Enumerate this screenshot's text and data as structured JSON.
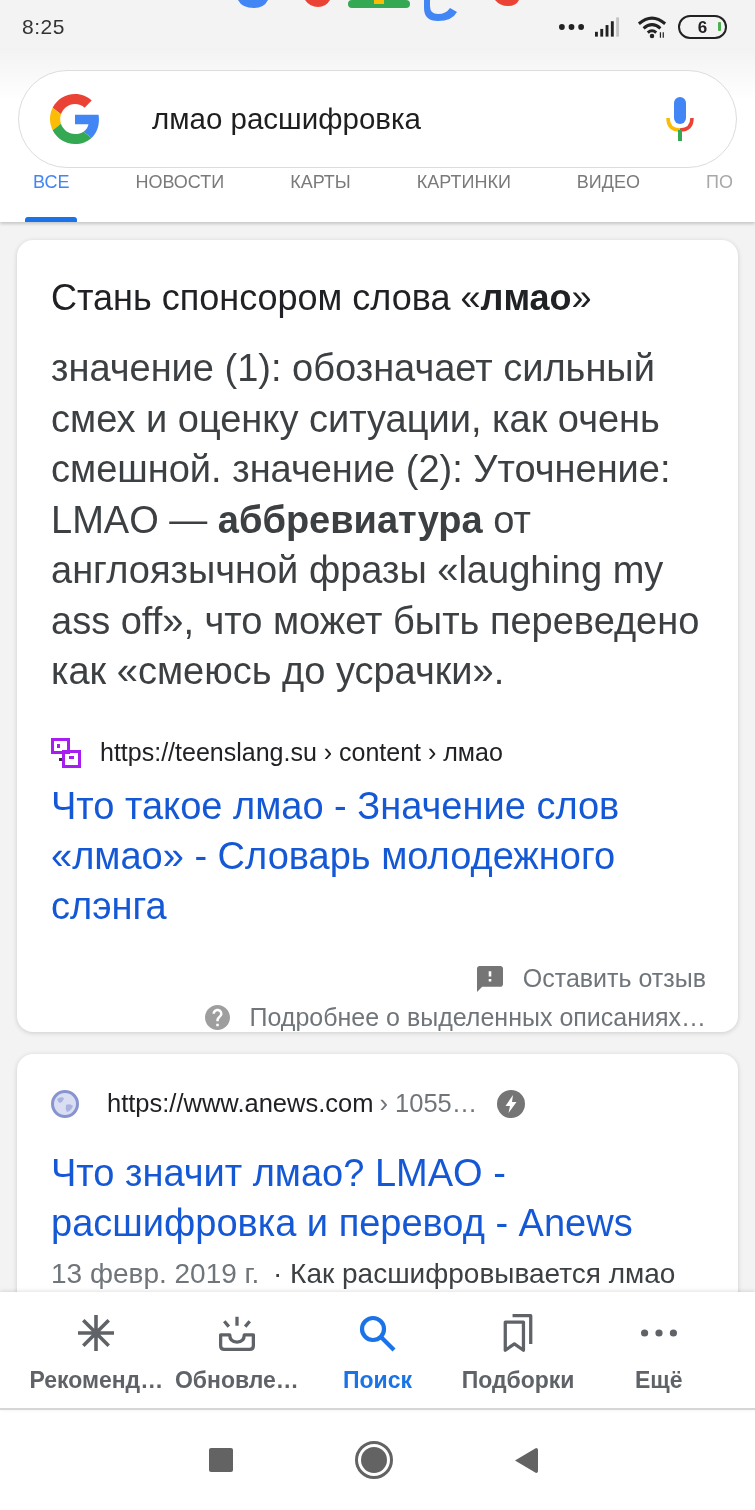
{
  "status_bar": {
    "time": "8:25",
    "battery": "6"
  },
  "search": {
    "query": "лмао расшифровка"
  },
  "tabs": [
    {
      "label": "ВСЕ",
      "selected": true
    },
    {
      "label": "НОВОСТИ",
      "selected": false
    },
    {
      "label": "КАРТЫ",
      "selected": false
    },
    {
      "label": "КАРТИНКИ",
      "selected": false
    },
    {
      "label": "ВИДЕО",
      "selected": false
    },
    {
      "label": "ПО",
      "selected": false
    }
  ],
  "featured_snippet": {
    "heading": "Стань спонсором слова «**лмао**»",
    "text": "значение (1): обозначает сильный смех и оценку ситуации, как очень смешной. значение (2): Уточнение: LMAO — **аббревиатура** от англоязычной фразы «laughing my ass off», что может быть переведено как «смеюсь до усрачки».",
    "source": "https://teenslang.su › content › лмао",
    "title": "Что такое лмао - Значение слов «лмао» - Словарь молодежного слэнга",
    "feedback": "Оставить отзыв",
    "about": "Подробнее о выделенных описаниях…"
  },
  "results": [
    {
      "site": "https://www.anews.com",
      "path": "› 1055…",
      "amp": true,
      "title": "Что значит лмао? LMAO - расшифровка и перевод - Anews",
      "date": "13 февр. 2019 г.",
      "snippet": "· Как расшифровывается лмао"
    }
  ],
  "bottom_nav": [
    {
      "kind": "asterisk",
      "label": "Рекоменд…",
      "selected": false
    },
    {
      "kind": "updates",
      "label": "Обновле…",
      "selected": false
    },
    {
      "kind": "search",
      "label": "Поиск",
      "selected": true
    },
    {
      "kind": "collections",
      "label": "Подборки",
      "selected": false
    },
    {
      "kind": "more",
      "label": "Ещё",
      "selected": false
    }
  ]
}
